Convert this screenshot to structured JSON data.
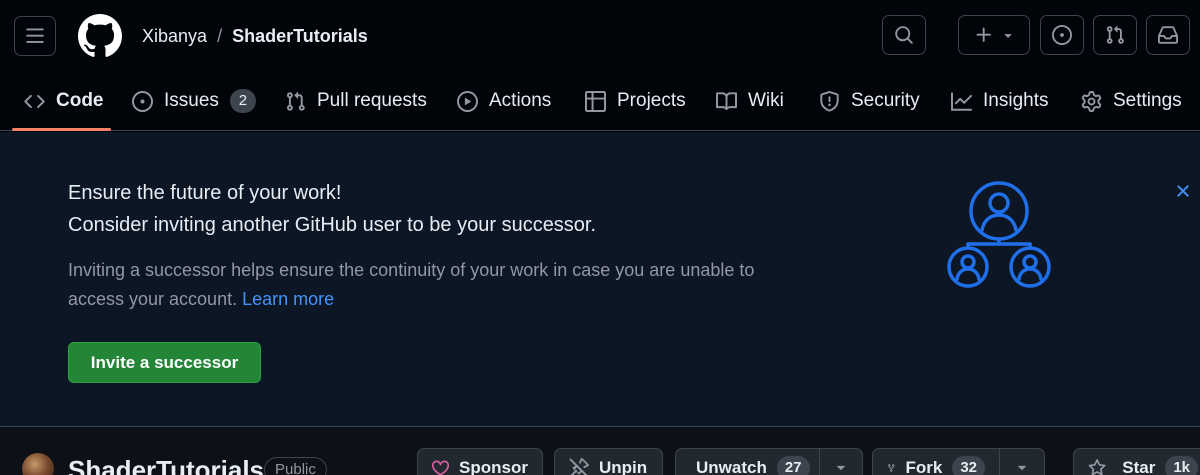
{
  "header": {
    "owner": "Xibanya",
    "separator": "/",
    "repo": "ShaderTutorials"
  },
  "nav": {
    "tabs": [
      {
        "label": "Code",
        "icon": "code-icon",
        "active": true
      },
      {
        "label": "Issues",
        "icon": "issue-opened-icon",
        "count": "2"
      },
      {
        "label": "Pull requests",
        "icon": "git-pull-request-icon"
      },
      {
        "label": "Actions",
        "icon": "play-icon"
      },
      {
        "label": "Projects",
        "icon": "table-icon"
      },
      {
        "label": "Wiki",
        "icon": "book-icon"
      },
      {
        "label": "Security",
        "icon": "shield-icon"
      },
      {
        "label": "Insights",
        "icon": "graph-icon"
      },
      {
        "label": "Settings",
        "icon": "gear-icon"
      }
    ]
  },
  "banner": {
    "title": "Ensure the future of your work!",
    "subtitle": "Consider inviting another GitHub user to be your successor.",
    "description": "Inviting a successor helps ensure the continuity of your work in case you are unable to access your account.",
    "link": "Learn more",
    "button": "Invite a successor"
  },
  "repo_header": {
    "name": "ShaderTutorials",
    "visibility": "Public",
    "sponsor": "Sponsor",
    "unpin": "Unpin",
    "unwatch": "Unwatch",
    "watch_count": "27",
    "fork": "Fork",
    "fork_count": "32",
    "star": "Star",
    "star_count": "1k"
  },
  "colors": {
    "background": "#010409",
    "banner": "#0d1625",
    "accent_blue": "#4493f8",
    "active_tab_underline": "#f78166",
    "primary_green": "#238636",
    "sponsor_pink": "#db61a2"
  }
}
